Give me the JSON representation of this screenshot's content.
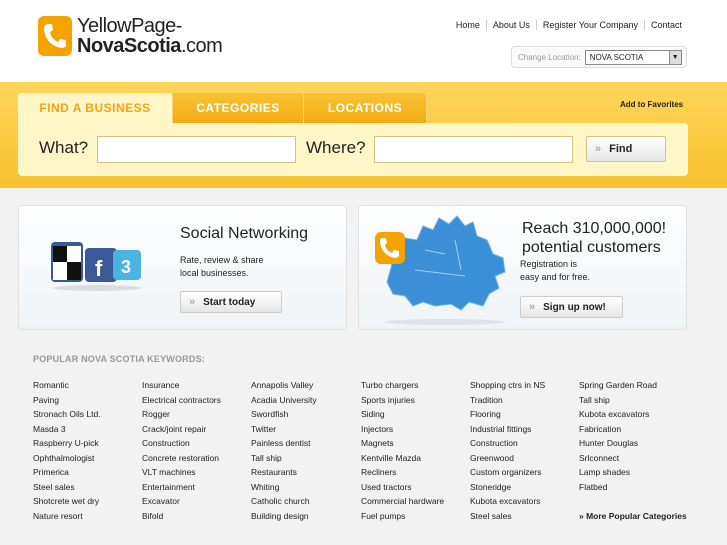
{
  "logo": {
    "line1": "YellowPage-",
    "line2_bold": "NovaScotia",
    "line2_rest": ".com"
  },
  "topnav": [
    "Home",
    "About Us",
    "Register Your Company",
    "Contact"
  ],
  "location": {
    "label": "Change Location:",
    "selected": "NOVA SCOTIA"
  },
  "tabs": [
    "FIND A BUSINESS",
    "CATEGORIES",
    "LOCATIONS"
  ],
  "add_favorites": "Add to Favorites",
  "search": {
    "what_label": "What?",
    "where_label": "Where?",
    "find_label": "Find"
  },
  "social": {
    "title": "Social Networking",
    "desc1": "Rate, review & share",
    "desc2": "local businesses.",
    "button": "Start today"
  },
  "reach": {
    "title1": "Reach 310,000,000!",
    "title2": "potential customers",
    "desc1": "Registration is",
    "desc2": "easy and for free.",
    "button": "Sign up now!"
  },
  "keywords": {
    "title": "POPULAR NOVA SCOTIA KEYWORDS:",
    "columns": [
      [
        "Romantic",
        "Paving",
        "Stronach Oils Ltd.",
        "Masda 3",
        "Raspberry U-pick",
        "Ophthalmologist",
        "Primerica",
        "Steel sales",
        "Shotcrete wet dry",
        "Nature resort"
      ],
      [
        "Insurance",
        "Electrical contractors",
        "Rogger",
        "Crack/joint repair",
        "Construction",
        "Concrete restoration",
        "VLT machines",
        "Entertainment",
        "Excavator",
        "Bifold"
      ],
      [
        "Annapolis Valley",
        "Acadia University",
        "Swordfish",
        "Twitter",
        "Painless dentist",
        "Tall ship",
        "Restaurants",
        "Whiting",
        "Catholic church",
        "Building design"
      ],
      [
        "Turbo chargers",
        "Sports injuries",
        "Siding",
        "Injectors",
        "Magnets",
        "Kentville Mazda",
        "Recliners",
        "Used tractors",
        "Commercial hardware",
        "Fuel pumps"
      ],
      [
        "Shopping ctrs in NS",
        "Tradition",
        "Flooring",
        "Industrial fittings",
        "Construction",
        "Greenwood",
        "Custom organizers",
        "Stoneridge",
        "Kubota excavators",
        "Steel sales"
      ],
      [
        "Spring Garden Road",
        "Tall ship",
        "Kubota excavators",
        "Fabrication",
        "Hunter Douglas",
        "Srlconnect",
        "Lamp shades",
        "Flatbed"
      ]
    ],
    "more": "» More Popular Categories"
  }
}
